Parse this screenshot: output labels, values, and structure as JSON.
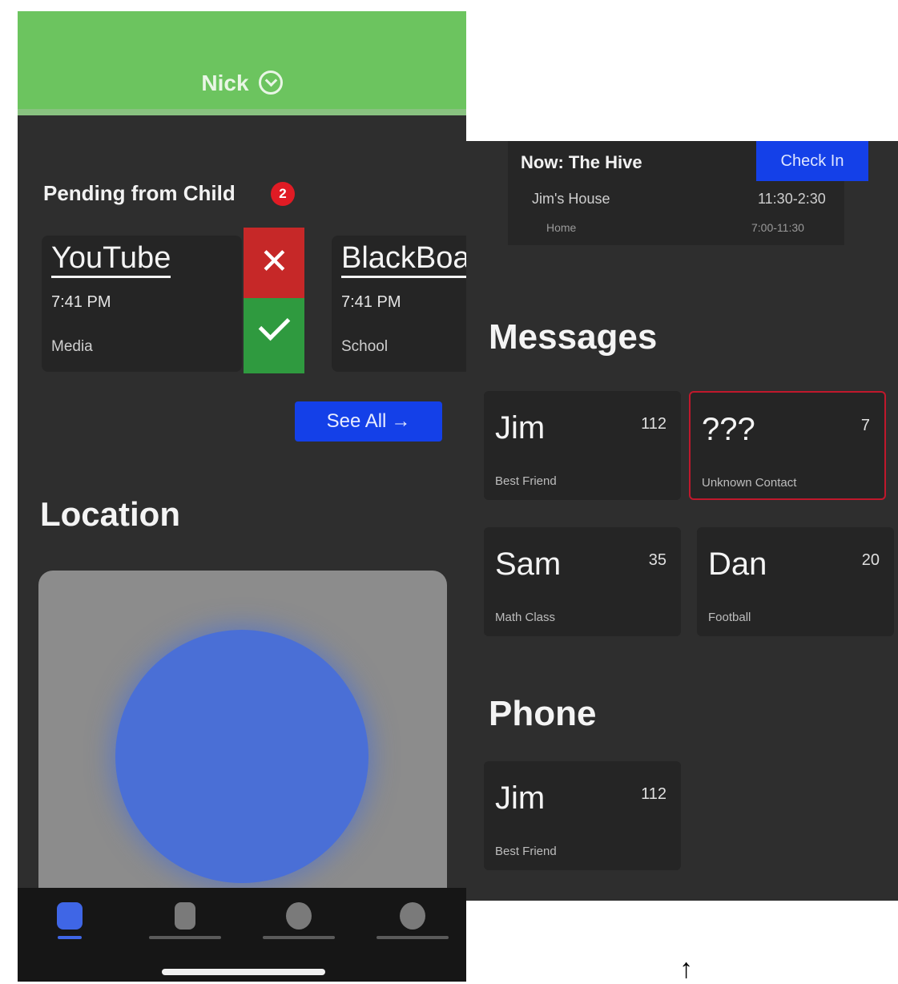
{
  "left_screen": {
    "header": {
      "title": "Nick",
      "icon": "chevron-down-circle-icon",
      "color": "#6cc45f"
    },
    "pending": {
      "label": "Pending from Child",
      "badge": "2",
      "requests": [
        {
          "name": "YouTube",
          "time": "7:41 PM",
          "category": "Media"
        },
        {
          "name": "BlackBoard",
          "time": "7:41 PM",
          "category": "School"
        }
      ],
      "deny_icon": "close-icon",
      "approve_icon": "check-icon",
      "see_all": "See All",
      "see_all_arrow": "→"
    },
    "location": {
      "title": "Location"
    },
    "tabbar": {
      "tabs": [
        {
          "icon": "home-icon",
          "active": true
        },
        {
          "icon": "apps-icon",
          "active": false
        },
        {
          "icon": "location-icon",
          "active": false
        },
        {
          "icon": "profile-icon",
          "active": false
        }
      ],
      "accent": "#3f66e6"
    }
  },
  "right_screen": {
    "schedule": {
      "now_label": "Now: The Hive",
      "checkin_label": "Check In",
      "rows": [
        {
          "place": "Jim's House",
          "time": "11:30-2:30"
        },
        {
          "place": "Home",
          "time": "7:00-11:30"
        }
      ]
    },
    "messages": {
      "title": "Messages",
      "contacts": [
        {
          "name": "Jim",
          "count": "112",
          "relation": "Best Friend"
        },
        {
          "name": "???",
          "count": "7",
          "relation": "Unknown Contact",
          "flagged": true
        },
        {
          "name": "Sam",
          "count": "35",
          "relation": "Math Class"
        },
        {
          "name": "Dan",
          "count": "20",
          "relation": "Football"
        }
      ]
    },
    "phone": {
      "title": "Phone",
      "contacts": [
        {
          "name": "Jim",
          "count": "112",
          "relation": "Best Friend"
        }
      ]
    }
  },
  "annotation": {
    "arrow": "↑"
  },
  "colors": {
    "background": "#2e2e2e",
    "card": "#252525",
    "blue": "#1440e8",
    "red": "#c62828",
    "green": "#2f9a3f",
    "flag": "#c0182c"
  }
}
